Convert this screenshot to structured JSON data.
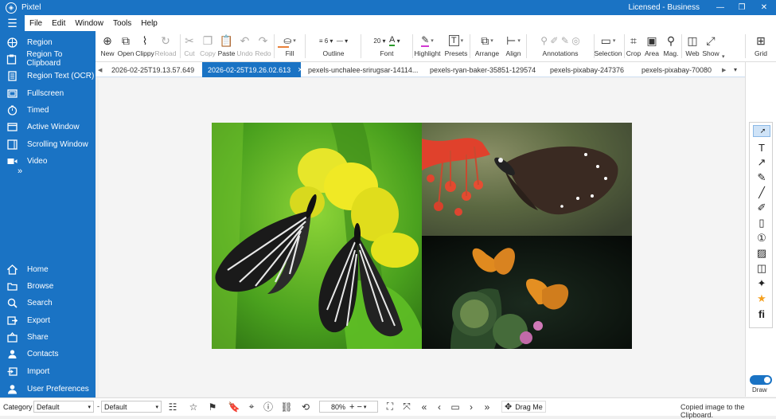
{
  "app": {
    "title": "Pixtel",
    "license": "Licensed - Business"
  },
  "menu": [
    "File",
    "Edit",
    "Window",
    "Tools",
    "Help"
  ],
  "sidebar": {
    "capture": [
      {
        "label": "Region",
        "icon": "crosshair-icon"
      },
      {
        "label": "Region To Clipboard",
        "icon": "clipboard-icon"
      },
      {
        "label": "Region Text (OCR)",
        "icon": "text-document-icon"
      },
      {
        "label": "Fullscreen",
        "icon": "fullscreen-icon"
      },
      {
        "label": "Timed",
        "icon": "timer-icon"
      },
      {
        "label": "Active Window",
        "icon": "window-icon"
      },
      {
        "label": "Scrolling Window",
        "icon": "scroll-window-icon"
      },
      {
        "label": "Video",
        "icon": "video-icon"
      }
    ],
    "more": "»",
    "bottom": [
      {
        "label": "Home",
        "icon": "home-icon"
      },
      {
        "label": "Browse",
        "icon": "folder-icon"
      },
      {
        "label": "Search",
        "icon": "search-icon"
      },
      {
        "label": "Export",
        "icon": "export-icon"
      },
      {
        "label": "Share",
        "icon": "share-icon"
      },
      {
        "label": "Contacts",
        "icon": "contacts-icon"
      },
      {
        "label": "Import",
        "icon": "import-icon"
      },
      {
        "label": "User Preferences",
        "icon": "user-icon"
      }
    ]
  },
  "toolbar": {
    "new": "New",
    "open": "Open",
    "clippy": "Clippy",
    "reload": "Reload",
    "cut": "Cut",
    "copy": "Copy",
    "paste": "Paste",
    "undo": "Undo",
    "redo": "Redo",
    "fill": "Fill",
    "outline": "Outline",
    "outline_width": "6",
    "font": "Font",
    "font_size": "20",
    "highlight": "Highlight",
    "presets": "Presets",
    "arrange": "Arrange",
    "align": "Align",
    "annotations": "Annotations",
    "selection": "Selection",
    "crop": "Crop",
    "area": "Area",
    "mag": "Mag.",
    "web": "Web",
    "show": "Show",
    "grid": "Grid"
  },
  "tabs": [
    "2026-02-25T19.13.57.649",
    "2026-02-25T19.26.02.613",
    "pexels-unchalee-srirugsar-14114...",
    "pexels-ryan-baker-35851-129574",
    "pexels-pixabay-247376",
    "pexels-pixabay-70080"
  ],
  "tab_close": "×",
  "draw_label": "Draw",
  "status": {
    "category_label": "Category",
    "category_value": "Default",
    "dash": "-",
    "sub_value": "Default",
    "zoom": "80%",
    "drag": "Drag Me",
    "message": "Copied image to the Clipboard."
  },
  "colors": {
    "accent": "#1a73c4",
    "fill_swatch": "#e8803a",
    "font_swatch": "#2a9a2a",
    "highlight_swatch": "#d23ad2"
  }
}
